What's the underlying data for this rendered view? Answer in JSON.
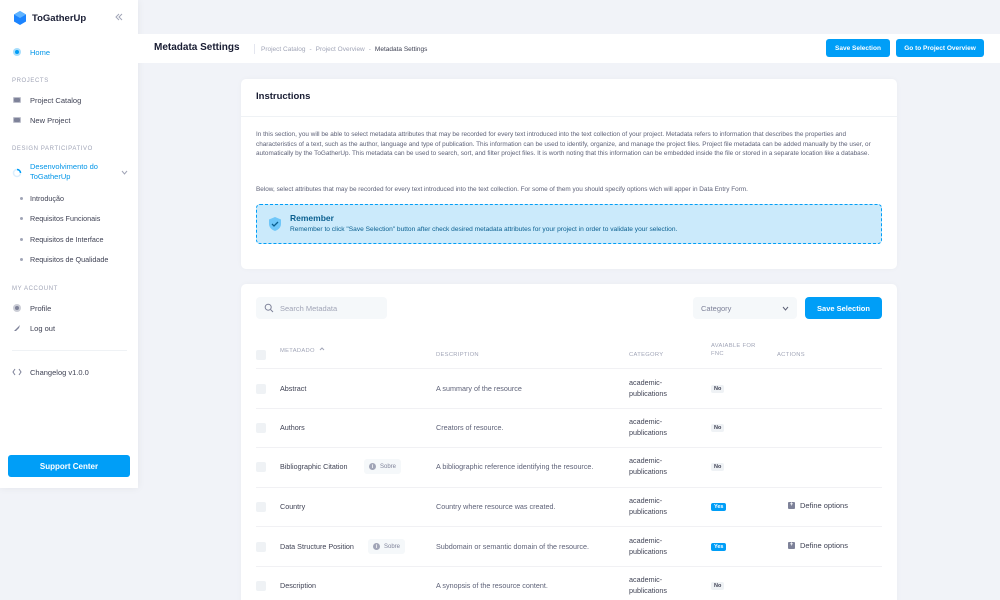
{
  "app": {
    "name": "ToGatherUp"
  },
  "colors": {
    "accent": "#009ef7",
    "notice_bg": "#cbeafb",
    "notice_text": "#0a5f8f"
  },
  "sidebar": {
    "home": "Home",
    "projects_section": "PROJECTS",
    "project_catalog": "Project Catalog",
    "new_project": "New Project",
    "design_section": "DESIGN PARTICIPATIVO",
    "design_active": "Desenvolvimento do ToGatherUp",
    "sub_items": [
      "Introdução",
      "Requisitos Funcionais",
      "Requisitos de Interface",
      "Requisitos de Qualidade"
    ],
    "account_section": "MY ACCOUNT",
    "profile": "Profile",
    "logout": "Log out",
    "changelog": "Changelog v1.0.0",
    "support": "Support Center"
  },
  "toolbar": {
    "title": "Metadata Settings",
    "breadcrumb": [
      "Project Catalog",
      "Project Overview",
      "Metadata Settings"
    ],
    "save_selection": "Save Selection",
    "go_to_overview": "Go to Project Overview"
  },
  "instructions": {
    "title": "Instructions",
    "paragraph1": "In this section, you will be able to select metadata attributes that may be recorded for every text introduced into the text collection of your project. Metadata refers to information that describes the properties and characteristics of a text, such as the author, language and type of publication. This information can be used to identify, organize, and manage the project files. Project file metadata can be added manually by the user, or automatically by the ToGatherUp. This metadata can be used to search, sort, and filter project files. It is worth noting that this information can be embedded inside the file or stored in a separate location like a database.",
    "paragraph2": "Below, select attributes that may be recorded for every text introduced into the text collection. For some of them you should specify options wich will apper in Data Entry Form.",
    "remember_title": "Remember",
    "remember_text": "Remember to click \"Save Selection\" button after check desired metadata attributes for your project in order to validate your selection."
  },
  "table": {
    "search_placeholder": "Search Metadata",
    "category_placeholder": "Category",
    "save_selection": "Save Selection",
    "headers": {
      "metadado": "METADADO",
      "description": "DESCRIPTION",
      "category": "CATEGORY",
      "available_line1": "AVAIABLE FOR",
      "available_line2": "FNC",
      "actions": "ACTIONS"
    },
    "sobre_label": "Sobre",
    "define_label": "Define options",
    "rows": [
      {
        "name": "Abstract",
        "description": "A summary of the resource",
        "category_line1": "academic-",
        "category_line2": "publications",
        "available": "No"
      },
      {
        "name": "Authors",
        "description": "Creators of resource.",
        "category_line1": "academic-",
        "category_line2": "publications",
        "available": "No"
      },
      {
        "name": "Bibliographic Citation",
        "description": "A bibliographic reference identifying the resource.",
        "category_line1": "academic-",
        "category_line2": "publications",
        "available": "No"
      },
      {
        "name": "Country",
        "description": "Country where resource was created.",
        "category_line1": "academic-",
        "category_line2": "publications",
        "available": "Yes"
      },
      {
        "name": "Data Structure Position",
        "description": "Subdomain or semantic domain of the resource.",
        "category_line1": "academic-",
        "category_line2": "publications",
        "available": "Yes"
      },
      {
        "name": "Description",
        "description": "A synopsis of the resource content.",
        "category_line1": "academic-",
        "category_line2": "publications",
        "available": "No"
      }
    ]
  }
}
